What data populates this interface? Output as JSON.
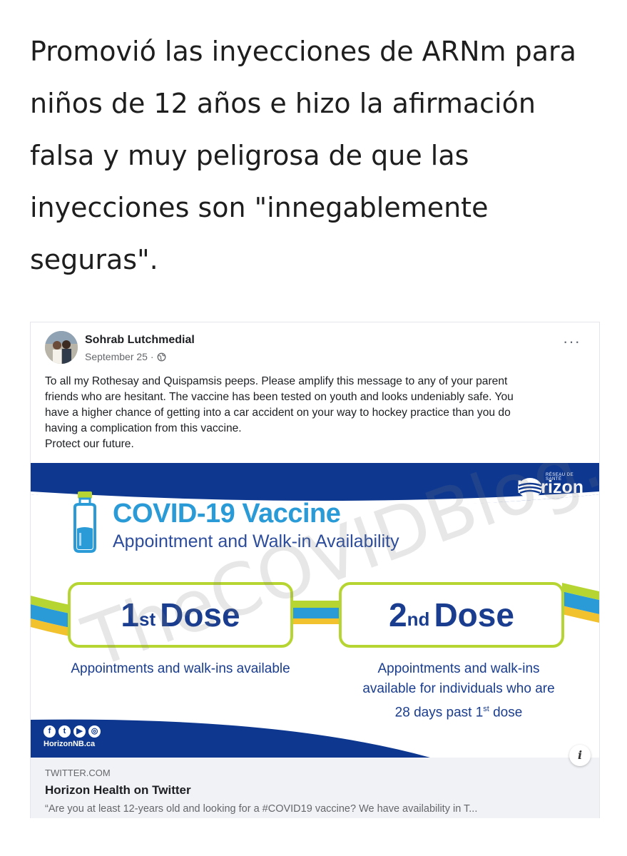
{
  "headline": {
    "lines": [
      "Promovió las inyecciones de ARNm para",
      "niños de 12 años e hizo la afirmación",
      "falsa y muy peligrosa de que las",
      "inyecciones son \"innegablemente",
      "seguras\"."
    ]
  },
  "post": {
    "author": "Sohrab Lutchmedial",
    "date": "September 25 ·",
    "more_icon": "ellipsis-icon",
    "text_lines": [
      "To all my Rothesay and Quispamsis peeps. Please amplify this message to any of your parent",
      "friends who are hesitant. The vaccine has been tested on youth and looks undeniably safe. You",
      "have a higher chance of getting into a car accident on your way to hockey practice than you do",
      "having a complication from this vaccine.",
      "Protect our future."
    ]
  },
  "banner": {
    "logo": "Horizon",
    "logo_small": "RÉSEAU DE SANTÉ",
    "title": "COVID-19 Vaccine",
    "subtitle": "Appointment and Walk-in Availability",
    "dose1_num": "1",
    "dose1_sup": "st",
    "dose1_word": "Dose",
    "dose2_num": "2",
    "dose2_sup": "nd",
    "dose2_word": "Dose",
    "dose1_note": "Appointments and walk-ins available",
    "dose2_note_a": "Appointments and walk-ins",
    "dose2_note_b": "available for individuals who are",
    "dose2_note_c": "28 days past 1",
    "dose2_note_sup": "st",
    "dose2_note_d": " dose",
    "site": "HorizonNB.ca",
    "watermark": "TheCOVIDBlog.com",
    "colors": {
      "navy": "#0e3890",
      "sky": "#2a9bd6",
      "lime": "#b7d532",
      "yellow": "#f2c12e"
    }
  },
  "link": {
    "domain": "TWITTER.COM",
    "title": "Horizon Health on Twitter",
    "description": "“Are you at least 12-years old and looking for a #COVID19 vaccine? We have availability in T...",
    "info": "i"
  }
}
